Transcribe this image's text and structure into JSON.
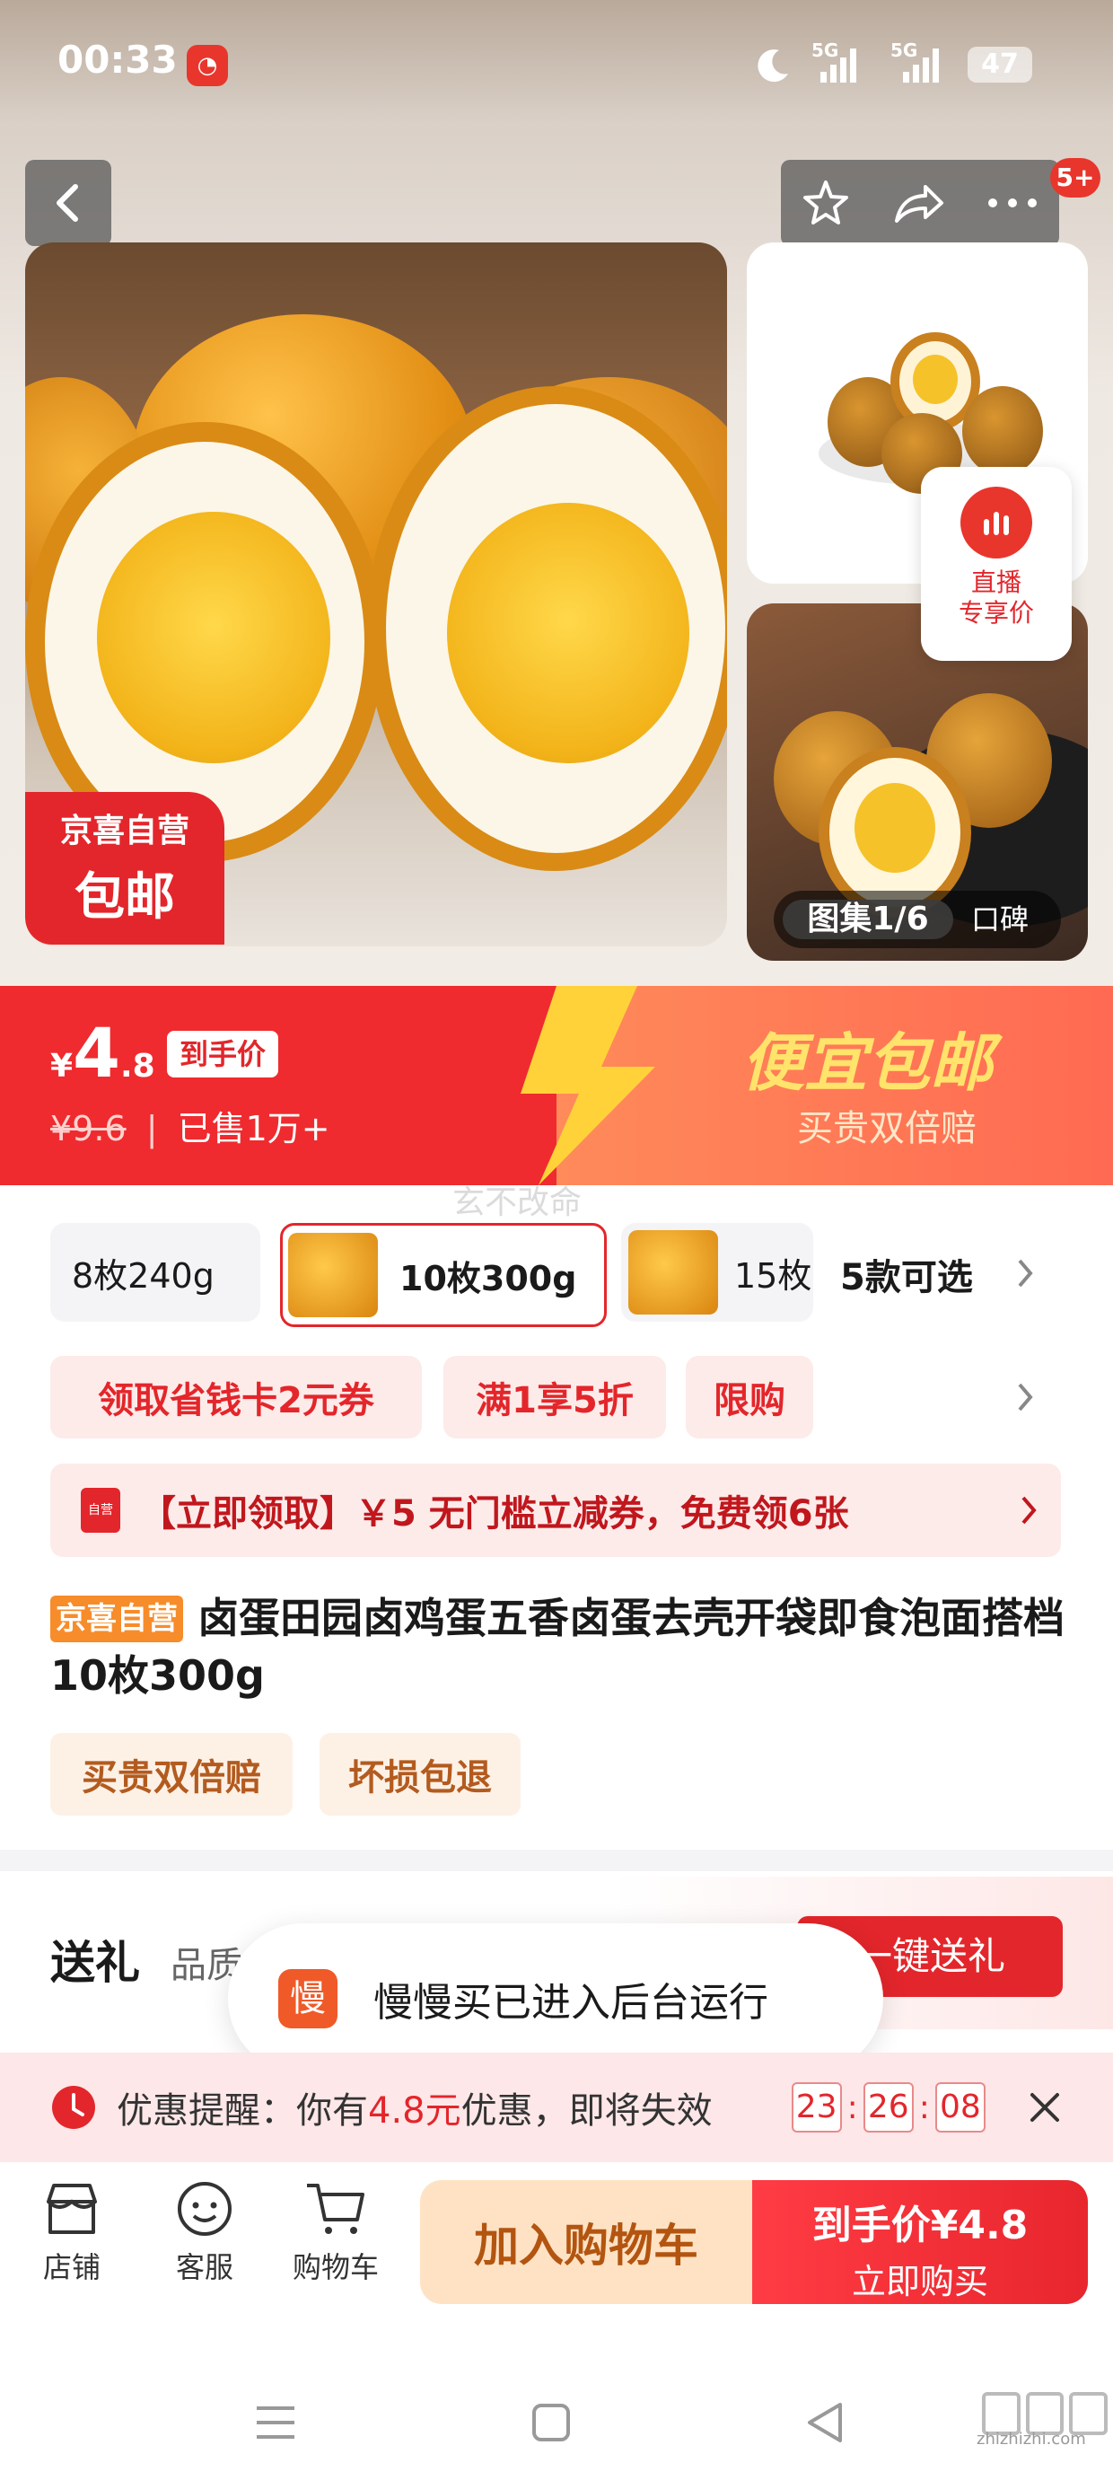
{
  "status_bar": {
    "time": "00:33",
    "signal1": "5G",
    "signal2": "5G",
    "battery": "47"
  },
  "nav": {
    "more_badge": "5+"
  },
  "gallery": {
    "jingxi_line1": "京喜自营",
    "jingxi_line2": "包邮",
    "counter": "图集1/6",
    "review_tab": "口碑",
    "live_line1": "直播",
    "live_line2": "专享价"
  },
  "price": {
    "currency": "¥",
    "integer": "4",
    "decimal": ".8",
    "label": "到手价",
    "original": "¥9.6",
    "separator": "|",
    "sold": "已售1万+",
    "promo_title": "便宜包邮",
    "promo_sub": "买贵双倍赔"
  },
  "watermark_mid": "玄不改命",
  "skus": {
    "items": [
      "8枚240g",
      "10枚300g",
      "15枚"
    ],
    "more": "5款可选"
  },
  "coupons": {
    "tags": [
      "领取省钱卡2元券",
      "满1享5折",
      "限购"
    ],
    "banner_icon": "自营",
    "banner_text": "【立即领取】￥5 无门槛立减券，免费领6张"
  },
  "product": {
    "badge": "京喜自营",
    "title": "卤蛋田园卤鸡蛋五香卤蛋去壳开袋即食泡面搭档 10枚300g",
    "tags": [
      "买贵双倍赔",
      "坏损包退"
    ]
  },
  "gift": {
    "label": "送礼",
    "sub": "品质",
    "button": "一键送礼"
  },
  "toast": {
    "icon": "慢",
    "text": "慢慢买已进入后台运行"
  },
  "reminder": {
    "prefix": "优惠提醒：你有",
    "amount": "4.8元",
    "suffix": "优惠，即将失效",
    "h": "23",
    "m": "26",
    "s": "08",
    "colon": ":"
  },
  "bottom_bar": {
    "shop": "店铺",
    "service": "客服",
    "cart": "购物车",
    "add_cart": "加入购物车",
    "buy_price_label": "到手价",
    "buy_price": "¥4.8",
    "buy_now": "立即购买"
  },
  "site_watermark": "zhizhizhi.com",
  "colors": {
    "accent": "#e3262b",
    "orange": "#ff7a3d"
  }
}
